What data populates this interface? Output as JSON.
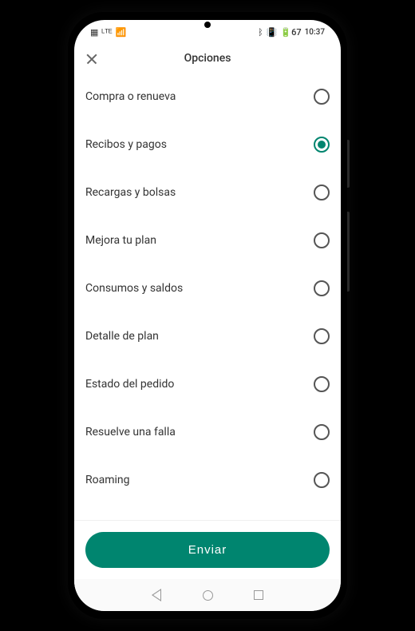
{
  "status_bar": {
    "time": "10:37",
    "battery": "67"
  },
  "header": {
    "title": "Opciones"
  },
  "options": [
    {
      "label": "Compra o renueva",
      "selected": false
    },
    {
      "label": "Recibos y pagos",
      "selected": true
    },
    {
      "label": "Recargas y bolsas",
      "selected": false
    },
    {
      "label": "Mejora tu plan",
      "selected": false
    },
    {
      "label": "Consumos y saldos",
      "selected": false
    },
    {
      "label": "Detalle de plan",
      "selected": false
    },
    {
      "label": "Estado del pedido",
      "selected": false
    },
    {
      "label": "Resuelve una falla",
      "selected": false
    },
    {
      "label": "Roaming",
      "selected": false
    }
  ],
  "footer": {
    "submit_label": "Enviar"
  }
}
